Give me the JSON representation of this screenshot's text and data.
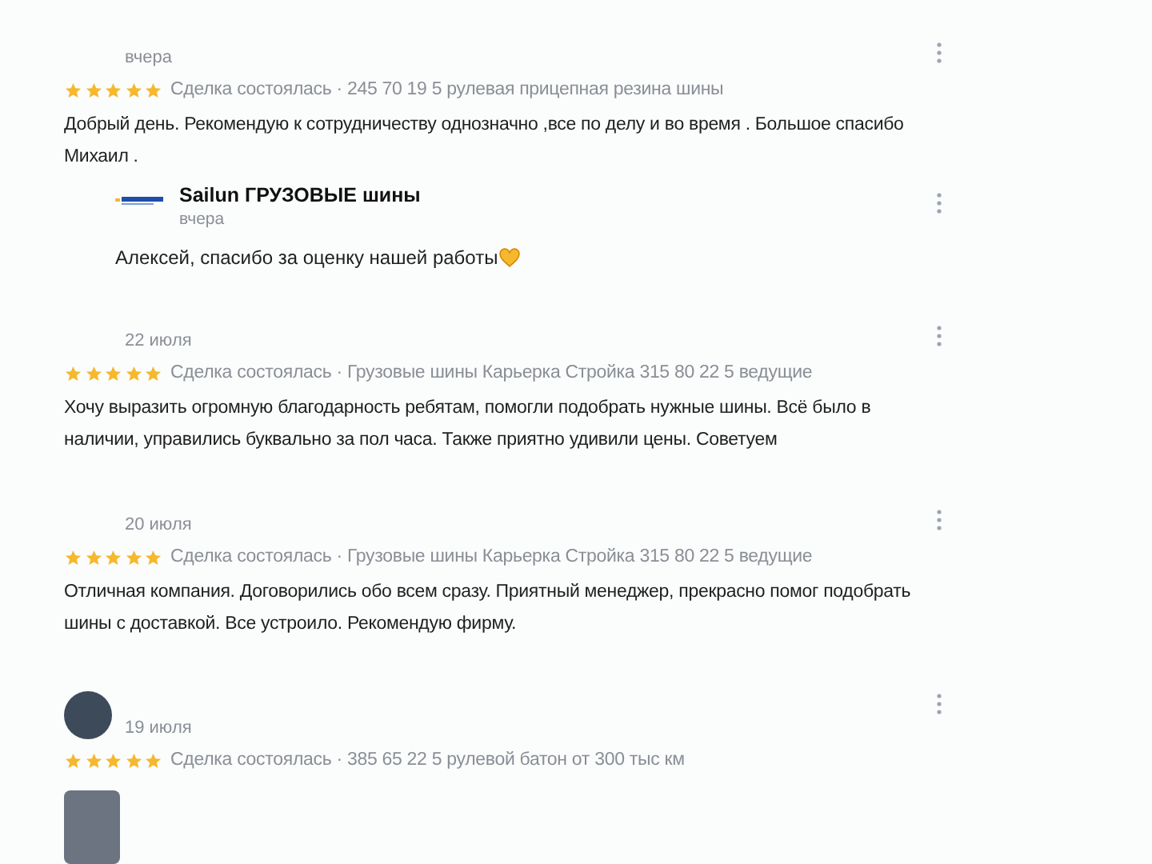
{
  "reviews": [
    {
      "date": "вчера",
      "avatar": false,
      "stars": 5,
      "deal": "Сделка состоялась · 245 70 19 5 рулевая прицепная резина шины",
      "text": "Добрый день. Рекомендую к сотрудничеству однозначно ,все по делу и во время . Большое спасибо Михаил .",
      "reply": {
        "name": "Sailun ГРУЗОВЫЕ шины",
        "date": "вчера",
        "text": "Алексей, спасибо за оценку нашей работы"
      },
      "has_photo": false
    },
    {
      "date": "22 июля",
      "avatar": false,
      "stars": 5,
      "deal": "Сделка состоялась · Грузовые шины Карьерка Стройка 315 80 22 5 ведущие",
      "text": "Хочу выразить огромную благодарность ребятам, помогли подобрать нужные шины. Всё было в наличии, управились буквально за пол часа. Также приятно удивили цены. Советуем",
      "has_photo": false
    },
    {
      "date": "20 июля",
      "avatar": false,
      "stars": 5,
      "deal": "Сделка состоялась · Грузовые шины Карьерка Стройка 315 80 22 5 ведущие",
      "text": "Отличная компания. Договорились обо всем сразу. Приятный менеджер, прекрасно помог подобрать шины с доставкой. Все устроило. Рекомендую фирму.",
      "has_photo": false
    },
    {
      "date": "19 июля",
      "avatar": true,
      "stars": 5,
      "deal": "Сделка состоялась · 385 65 22 5 рулевой батон от 300 тыс км",
      "has_photo": true
    }
  ]
}
